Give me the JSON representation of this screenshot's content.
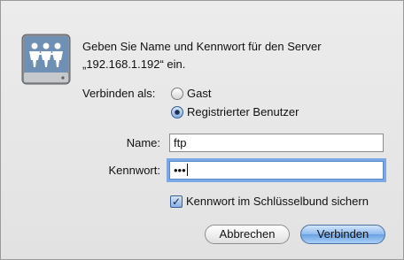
{
  "prompt": {
    "line1": "Geben Sie Name und Kennwort für den Server",
    "line2": "„192.168.1.192“ ein."
  },
  "connect_as": {
    "label": "Verbinden als:",
    "options": [
      {
        "label": "Gast",
        "selected": false
      },
      {
        "label": "Registrierter Benutzer",
        "selected": true
      }
    ]
  },
  "name_field": {
    "label": "Name:",
    "value": "ftp"
  },
  "password_field": {
    "label": "Kennwort:",
    "value": "•••"
  },
  "keychain": {
    "label": "Kennwort im Schlüsselbund sichern",
    "checked": true
  },
  "buttons": {
    "cancel": "Abbrechen",
    "connect": "Verbinden"
  },
  "icons": {
    "server": "shared-server-icon"
  },
  "colors": {
    "accent": "#7aa7e6",
    "default_button": "#8fbaee"
  }
}
